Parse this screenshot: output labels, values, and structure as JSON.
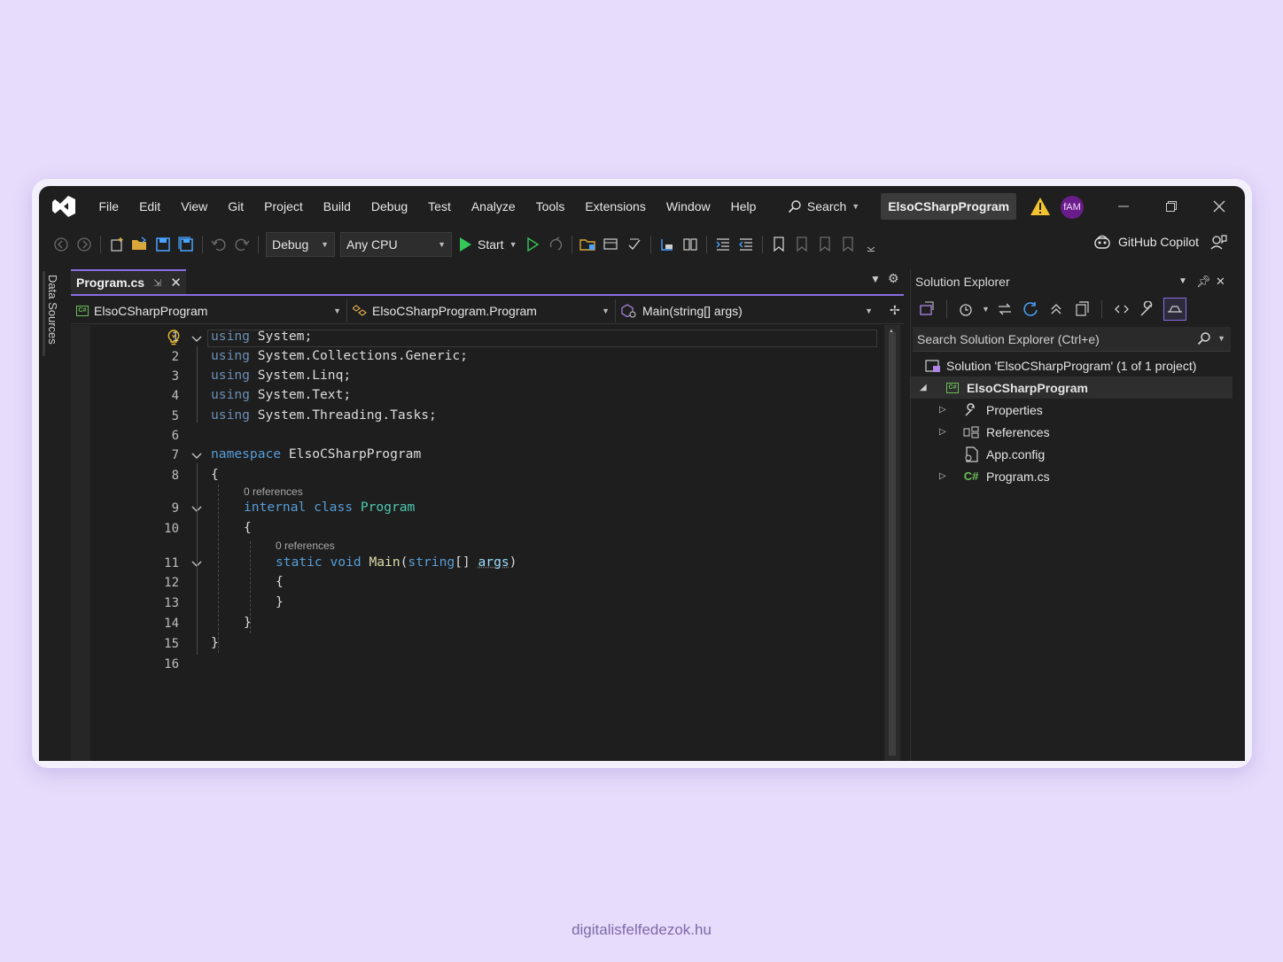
{
  "menu": {
    "items": [
      "File",
      "Edit",
      "View",
      "Git",
      "Project",
      "Build",
      "Debug",
      "Test",
      "Analyze",
      "Tools",
      "Extensions",
      "Window",
      "Help"
    ],
    "search_label": "Search",
    "project_title": "ElsoCSharpProgram",
    "avatar_initials": "fAM"
  },
  "toolbar": {
    "configuration": "Debug",
    "platform": "Any CPU",
    "start_label": "Start",
    "copilot_label": "GitHub Copilot"
  },
  "side_tab": {
    "label": "Data Sources"
  },
  "editor": {
    "tab_label": "Program.cs",
    "nav": {
      "project": "ElsoCSharpProgram",
      "class": "ElsoCSharpProgram.Program",
      "member": "Main(string[] args)"
    },
    "line_numbers": [
      "1",
      "2",
      "3",
      "4",
      "5",
      "6",
      "7",
      "8",
      "9",
      "10",
      "11",
      "12",
      "13",
      "14",
      "15",
      "16"
    ],
    "codelens_class": "0 references",
    "codelens_method": "0 references",
    "code": {
      "using_kw": "using",
      "u1": "System;",
      "u2": "System.Collections.Generic;",
      "u3": "System.Linq;",
      "u4": "System.Text;",
      "u5": "System.Threading.Tasks;",
      "namespace_kw": "namespace",
      "namespace_name": "ElsoCSharpProgram",
      "open_brace": "{",
      "close_brace": "}",
      "internal_kw": "internal",
      "class_kw": "class",
      "class_name": "Program",
      "static_kw": "static",
      "void_kw": "void",
      "method_name": "Main",
      "paren_open": "(",
      "string_kw": "string",
      "brackets": "[] ",
      "param_name": "args",
      "paren_close": ")"
    }
  },
  "solution_explorer": {
    "title": "Solution Explorer",
    "search_placeholder": "Search Solution Explorer (Ctrl+e)",
    "solution_label": "Solution 'ElsoCSharpProgram' (1 of 1 project)",
    "project_label": "ElsoCSharpProgram",
    "items": [
      "Properties",
      "References",
      "App.config",
      "Program.cs"
    ]
  },
  "footer": {
    "text": "digitalisfelfedezok.hu"
  },
  "colors": {
    "accent": "#8a6ee3",
    "keyword": "#569cd6",
    "type": "#4ec9b0",
    "method": "#dcdcaa",
    "start_green": "#34c759"
  }
}
